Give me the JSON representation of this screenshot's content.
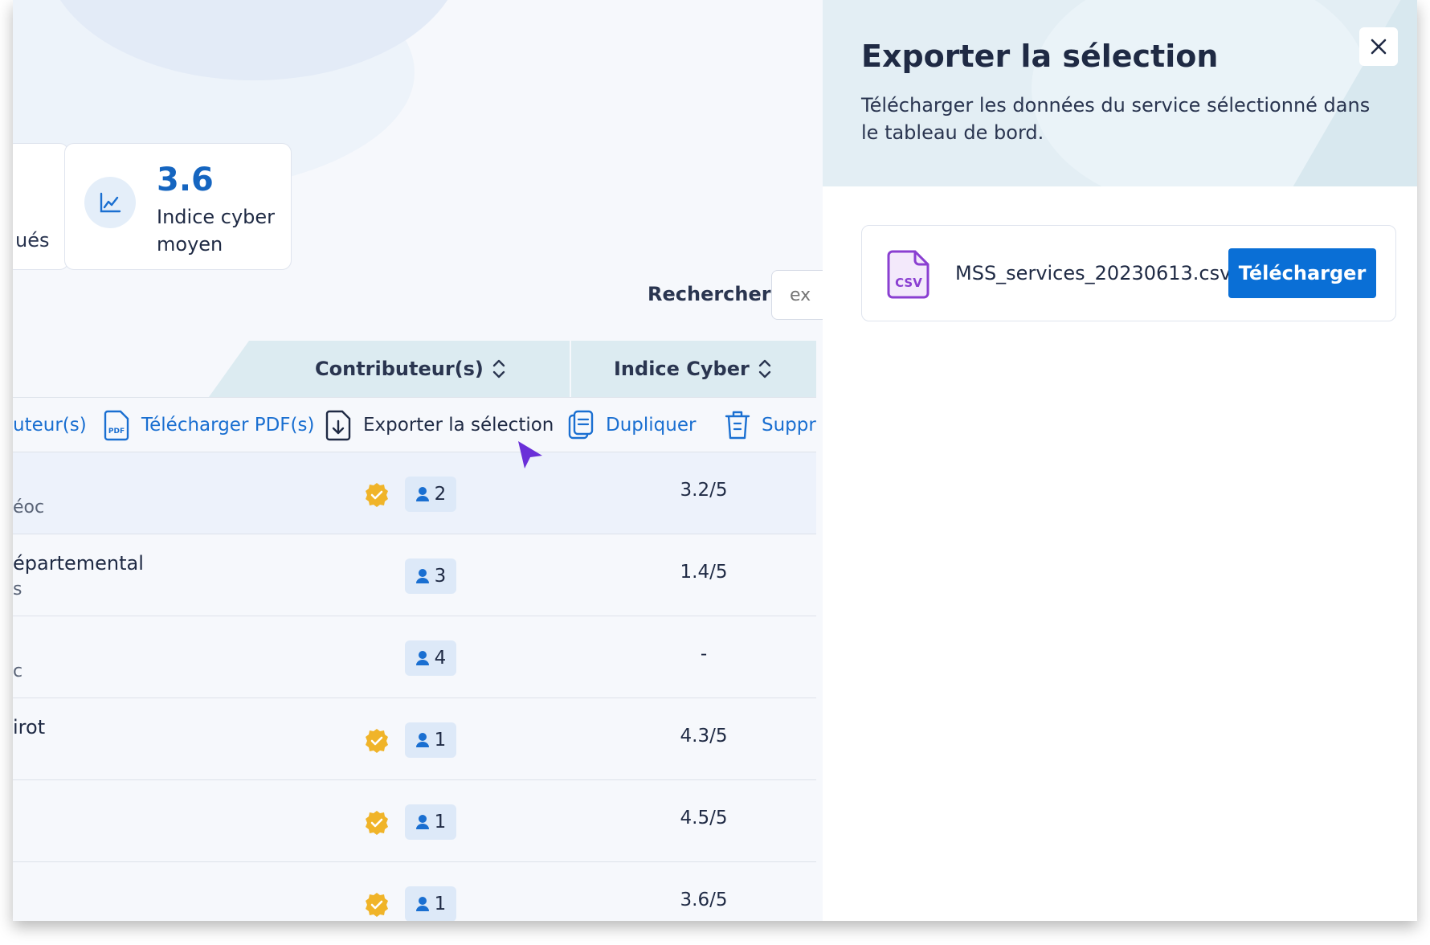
{
  "stats": {
    "stub_label": "ués",
    "value": "3.6",
    "label": "Indice cyber moyen"
  },
  "search": {
    "label": "Rechercher",
    "placeholder": "ex"
  },
  "table": {
    "columns": [
      {
        "label": "Contributeur(s)"
      },
      {
        "label": "Indice Cyber"
      }
    ],
    "actions": [
      {
        "label": "uteur(s)",
        "icon": "none"
      },
      {
        "label": "Télécharger PDF(s)",
        "icon": "pdf-icon"
      },
      {
        "label": "Exporter la sélection",
        "icon": "export-icon"
      },
      {
        "label": "Dupliquer",
        "icon": "duplicate-icon"
      },
      {
        "label": "Suppr",
        "icon": "trash-icon"
      }
    ],
    "rows": [
      {
        "name1": "",
        "name2": "éoc",
        "verified": true,
        "contributors": "2",
        "score": "3.2/5"
      },
      {
        "name1": "épartemental",
        "name2": "s",
        "verified": false,
        "contributors": "3",
        "score": "1.4/5"
      },
      {
        "name1": "",
        "name2": "c",
        "verified": false,
        "contributors": "4",
        "score": "-"
      },
      {
        "name1": "irot",
        "name2": "",
        "verified": true,
        "contributors": "1",
        "score": "4.3/5"
      },
      {
        "name1": "",
        "name2": "",
        "verified": true,
        "contributors": "1",
        "score": "4.5/5"
      },
      {
        "name1": "",
        "name2": "",
        "verified": true,
        "contributors": "1",
        "score": "3.6/5"
      }
    ]
  },
  "panel": {
    "title": "Exporter la sélection",
    "description": "Télécharger les données du service sélectionné dans le tableau de bord.",
    "file": {
      "icon_label": "CSV",
      "name": "MSS_services_20230613.csv",
      "download_label": "Télécharger"
    }
  },
  "colors": {
    "accent": "#0a6fd6",
    "panel_header_bg": "#e3eef4",
    "verified_badge": "#f0b429",
    "csv_icon": "#8a3fd1",
    "cursor": "#6a2fd8"
  }
}
